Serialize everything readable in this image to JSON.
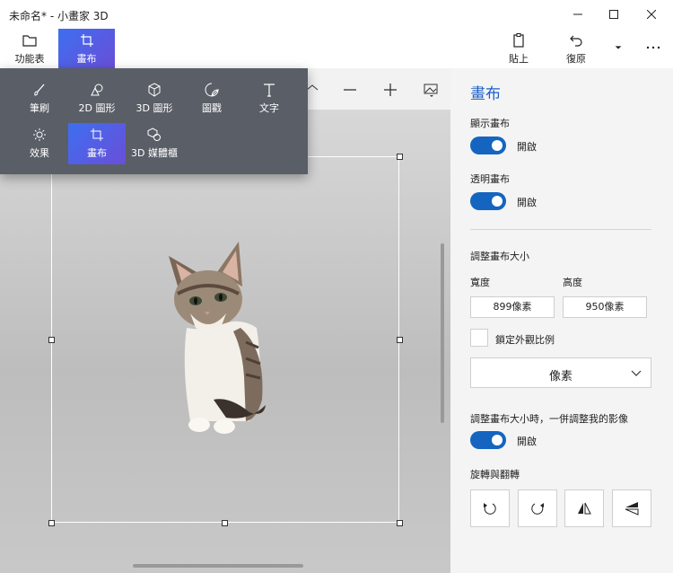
{
  "window": {
    "title": "未命名* - 小畫家 3D"
  },
  "toolbar": {
    "menu_label": "功能表",
    "canvas_label": "畫布",
    "paste_label": "貼上",
    "undo_label": "復原"
  },
  "flyout": {
    "items": [
      {
        "label": "筆刷",
        "icon": "brush-icon"
      },
      {
        "label": "2D 圖形",
        "icon": "2d-shapes-icon"
      },
      {
        "label": "3D 圖形",
        "icon": "3d-shapes-icon"
      },
      {
        "label": "圖戳",
        "icon": "stickers-icon"
      },
      {
        "label": "文字",
        "icon": "text-icon"
      },
      {
        "label": "效果",
        "icon": "effects-icon"
      },
      {
        "label": "畫布",
        "icon": "canvas-icon"
      },
      {
        "label": "3D 媒體櫃",
        "icon": "3d-library-icon"
      }
    ],
    "active_index": 6
  },
  "panel": {
    "title": "畫布",
    "show_canvas": {
      "label": "顯示畫布",
      "state": "開啟"
    },
    "transparent_canvas": {
      "label": "透明畫布",
      "state": "開啟"
    },
    "resize_title": "調整畫布大小",
    "width_label": "寬度",
    "height_label": "高度",
    "width_value": "899像素",
    "height_value": "950像素",
    "lock_aspect_label": "鎖定外觀比例",
    "unit_value": "像素",
    "resize_image_label": "調整畫布大小時，一併調整我的影像",
    "resize_image_state": "開啟",
    "rotate_flip_label": "旋轉與翻轉"
  },
  "colors": {
    "accent": "#1565c0",
    "active_gradient_start": "#3d6ff0",
    "active_gradient_end": "#6a4ed8",
    "flyout_bg": "#5a5e66"
  }
}
